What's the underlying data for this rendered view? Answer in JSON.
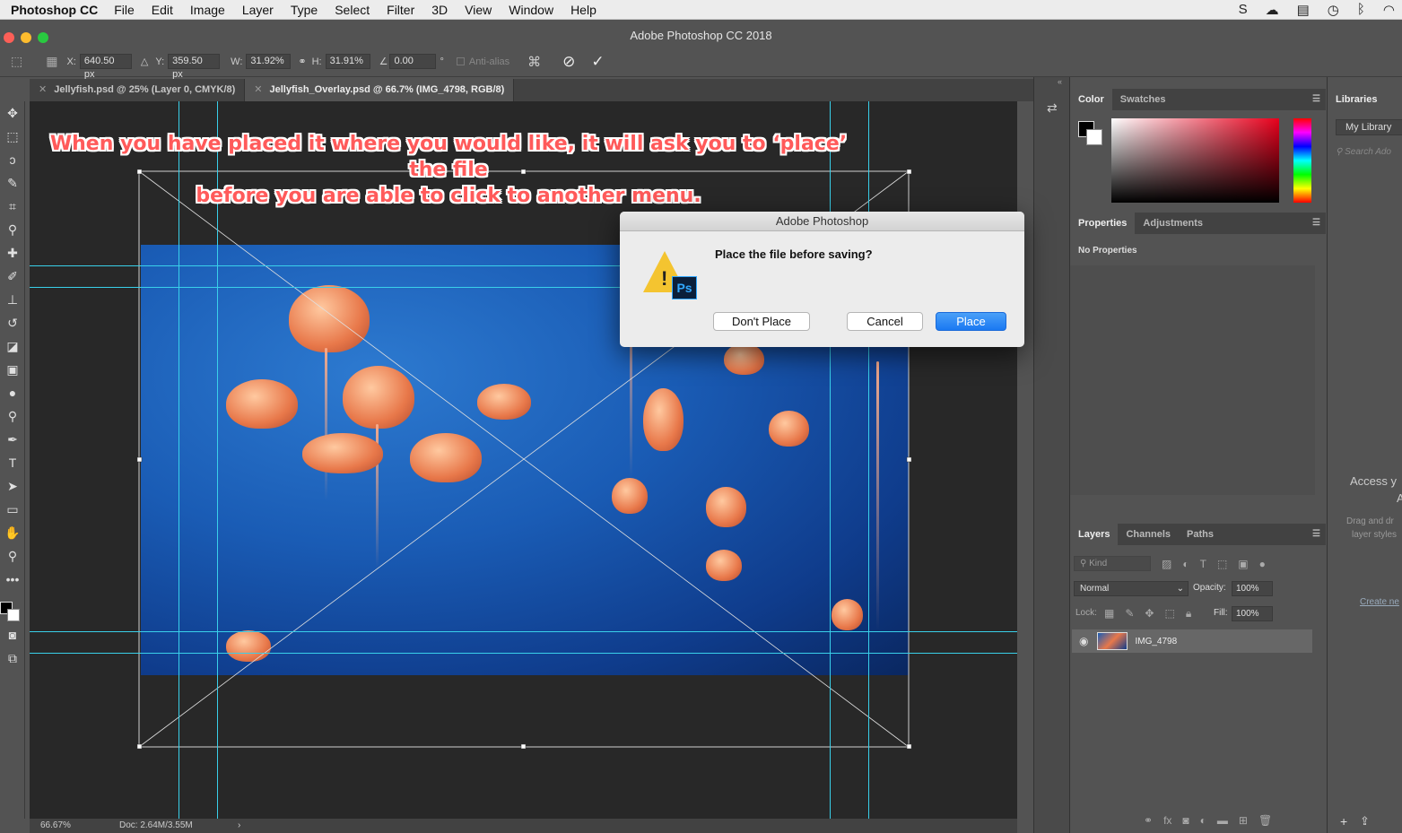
{
  "menubar": {
    "app": "Photoshop CC",
    "items": [
      "File",
      "Edit",
      "Image",
      "Layer",
      "Type",
      "Select",
      "Filter",
      "3D",
      "View",
      "Window",
      "Help"
    ]
  },
  "window": {
    "title": "Adobe Photoshop CC 2018"
  },
  "options": {
    "x_label": "X:",
    "x_value": "640.50 px",
    "y_label": "Y:",
    "y_value": "359.50 px",
    "w_label": "W:",
    "w_value": "31.92%",
    "h_label": "H:",
    "h_value": "31.91%",
    "angle_value": "0.00",
    "angle_unit": "°",
    "antialias_label": "Anti-alias"
  },
  "tabs": [
    {
      "label": "Jellyfish.psd @ 25% (Layer 0, CMYK/8)"
    },
    {
      "label": "Jellyfish_Overlay.psd @ 66.7% (IMG_4798, RGB/8)"
    }
  ],
  "annotation": {
    "line1": "When you have placed it where you would like, it will ask you to ‘place’ the file",
    "line2": "before you are able to click to another menu."
  },
  "dialog": {
    "title": "Adobe Photoshop",
    "message": "Place the file before saving?",
    "icon_badge": "Ps",
    "buttons": {
      "dont_place": "Don't Place",
      "cancel": "Cancel",
      "place": "Place"
    }
  },
  "status": {
    "zoom": "66.67%",
    "doc": "Doc: 2.64M/3.55M"
  },
  "color_panel": {
    "tabs": [
      "Color",
      "Swatches"
    ]
  },
  "properties_panel": {
    "tabs": [
      "Properties",
      "Adjustments"
    ],
    "content": "No Properties"
  },
  "layers_panel": {
    "tabs": [
      "Layers",
      "Channels",
      "Paths"
    ],
    "filter_placeholder": "Kind",
    "blend_mode": "Normal",
    "opacity_label": "Opacity:",
    "opacity_value": "100%",
    "lock_label": "Lock:",
    "fill_label": "Fill:",
    "fill_value": "100%",
    "layers": [
      {
        "name": "IMG_4798",
        "visible": true
      }
    ]
  },
  "libraries_panel": {
    "title": "Libraries",
    "library": "My Library",
    "search_placeholder": "Search Ado",
    "access_text": "Access y",
    "access_text2": "A",
    "drag_text": "Drag and dr",
    "drag_text2": "layer styles",
    "create_link": "Create ne"
  },
  "colors": {
    "accent": "#1a79f2",
    "guide": "#39d0ea",
    "annotation": "#ff5a5a"
  }
}
